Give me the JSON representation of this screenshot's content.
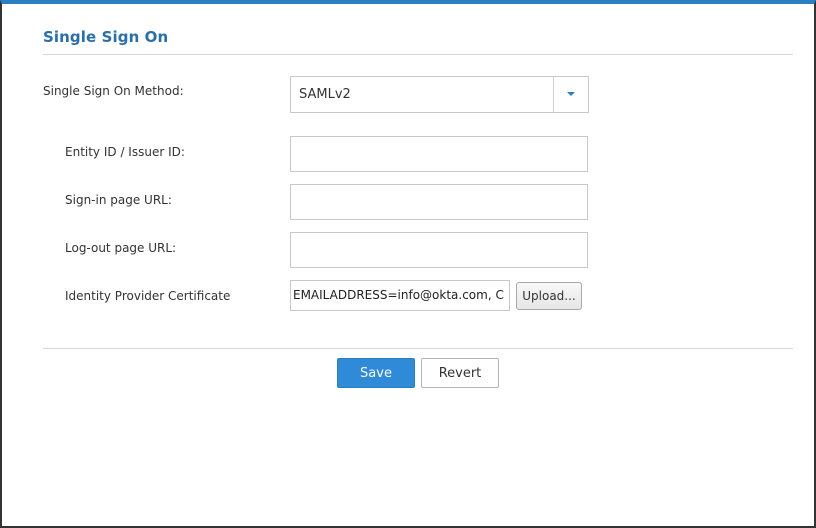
{
  "page": {
    "title": "Single Sign On"
  },
  "form": {
    "sso_method": {
      "label": "Single Sign On Method:",
      "value": "SAMLv2"
    },
    "entity_id": {
      "label": "Entity ID / Issuer ID:",
      "value": ""
    },
    "signin_url": {
      "label": "Sign-in page URL:",
      "value": ""
    },
    "logout_url": {
      "label": "Log-out page URL:",
      "value": ""
    },
    "certificate": {
      "label": "Identity Provider Certificate",
      "value": "EMAILADDRESS=info@okta.com, C",
      "upload_label": "Upload..."
    }
  },
  "actions": {
    "save_label": "Save",
    "revert_label": "Revert"
  },
  "colors": {
    "accent": "#2a7fc1",
    "title": "#2b6fa8",
    "save_bg": "#2f8ad8"
  },
  "icons": {
    "dropdown": "chevron-down-icon"
  }
}
